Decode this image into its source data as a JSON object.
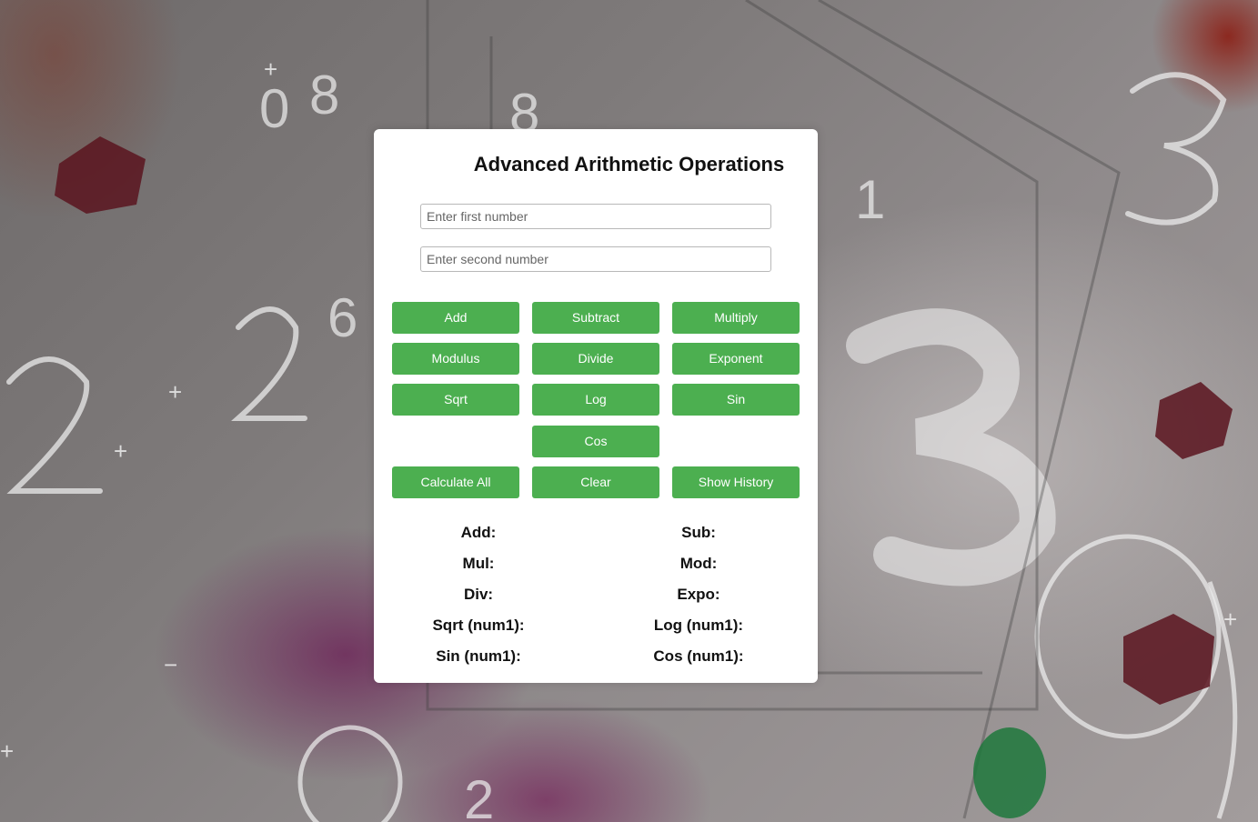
{
  "title": "Advanced Arithmetic Operations",
  "inputs": {
    "first": {
      "placeholder": "Enter first number",
      "value": ""
    },
    "second": {
      "placeholder": "Enter second number",
      "value": ""
    }
  },
  "buttons": {
    "add": "Add",
    "subtract": "Subtract",
    "multiply": "Multiply",
    "modulus": "Modulus",
    "divide": "Divide",
    "exponent": "Exponent",
    "sqrt": "Sqrt",
    "log": "Log",
    "sin": "Sin",
    "cos": "Cos",
    "calculate_all": "Calculate All",
    "clear": "Clear",
    "show_history": "Show History"
  },
  "results": {
    "add": "Add:",
    "sub": "Sub:",
    "mul": "Mul:",
    "mod": "Mod:",
    "div": "Div:",
    "expo": "Expo:",
    "sqrt": "Sqrt (num1):",
    "log": "Log (num1):",
    "sin": "Sin (num1):",
    "cos": "Cos (num1):"
  },
  "colors": {
    "button": "#4caf50",
    "card": "#ffffff"
  }
}
